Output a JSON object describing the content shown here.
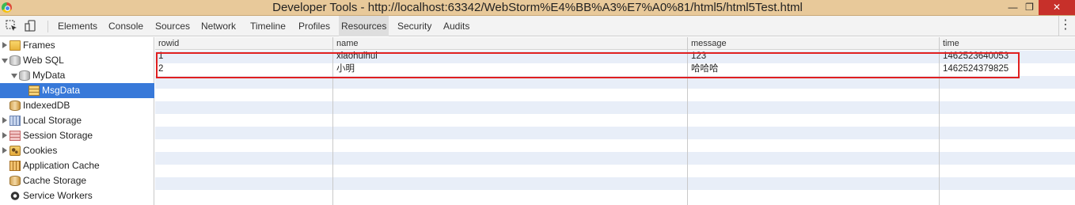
{
  "window": {
    "title": "Developer Tools - http://localhost:63342/WebStorm%E4%BB%A3%E7%A0%81/html5/html5Test.html",
    "min_label": "—",
    "max_label": "❐",
    "close_label": "✕"
  },
  "toolbar": {
    "tabs": [
      "Elements",
      "Console",
      "Sources",
      "Network",
      "Timeline",
      "Profiles",
      "Resources",
      "Security",
      "Audits"
    ],
    "active_tab": "Resources",
    "more_label": "⋮"
  },
  "sidebar": {
    "items": [
      {
        "label": "Frames",
        "icon": "folder-icon",
        "expander": "right"
      },
      {
        "label": "Web SQL",
        "icon": "database-icon",
        "expander": "down"
      },
      {
        "label": "MyData",
        "icon": "database-icon",
        "expander": "down"
      },
      {
        "label": "MsgData",
        "icon": "table-icon",
        "expander": "none",
        "selected": true
      },
      {
        "label": "IndexedDB",
        "icon": "indexeddb-icon",
        "expander": "none"
      },
      {
        "label": "Local Storage",
        "icon": "local-storage-icon",
        "expander": "right"
      },
      {
        "label": "Session Storage",
        "icon": "session-storage-icon",
        "expander": "right"
      },
      {
        "label": "Cookies",
        "icon": "cookie-icon",
        "expander": "right"
      },
      {
        "label": "Application Cache",
        "icon": "app-cache-icon",
        "expander": "none"
      },
      {
        "label": "Cache Storage",
        "icon": "cache-storage-icon",
        "expander": "none"
      },
      {
        "label": "Service Workers",
        "icon": "gear-icon",
        "expander": "none"
      }
    ]
  },
  "table": {
    "columns": [
      "rowid",
      "name",
      "message",
      "time"
    ],
    "rows": [
      [
        "1",
        "xiaohuihui",
        "123",
        "1462523640053"
      ],
      [
        "2",
        "小明",
        "哈哈哈",
        "1462524379825"
      ]
    ]
  },
  "colors": {
    "titlebar": "#e8c99a",
    "selected": "#3879d9",
    "alt_row": "#e8eef8",
    "highlight": "#e02020"
  }
}
